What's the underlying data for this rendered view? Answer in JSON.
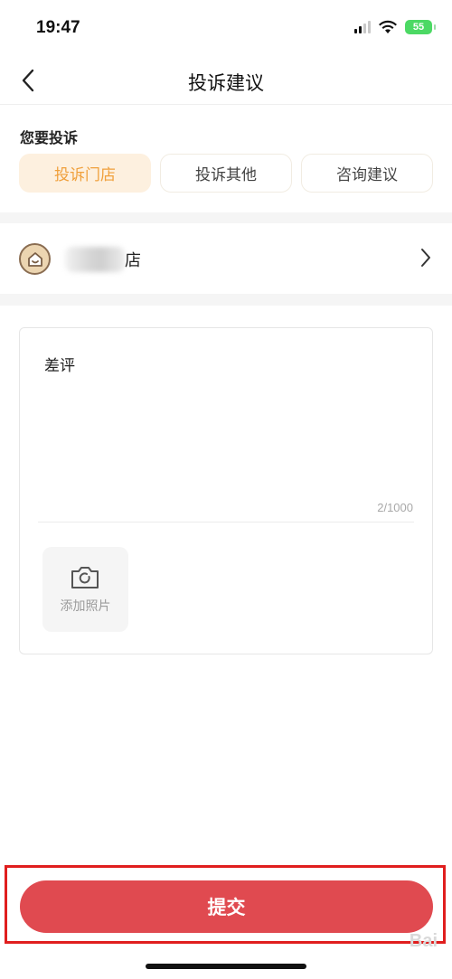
{
  "status_bar": {
    "time": "19:47",
    "battery": "55",
    "icons": [
      "signal-icon",
      "wifi-icon",
      "battery-icon"
    ]
  },
  "nav": {
    "title": "投诉建议",
    "back_icon": "chevron-left-icon"
  },
  "complaint_type": {
    "label": "您要投诉",
    "tabs": [
      {
        "label": "投诉门店",
        "active": true
      },
      {
        "label": "投诉其他",
        "active": false
      },
      {
        "label": "咨询建议",
        "active": false
      }
    ]
  },
  "store": {
    "name_visible": "店",
    "icon": "store-house-icon",
    "chevron": "chevron-right-icon"
  },
  "feedback": {
    "text": "差评",
    "char_count": "2/1000",
    "add_photo_label": "添加照片",
    "photo_icon": "camera-icon"
  },
  "submit": {
    "label": "提交"
  },
  "watermark": "Bai",
  "colors": {
    "accent_orange": "#f0a03c",
    "tab_active_bg": "#fdf0df",
    "submit_red": "#e04a50",
    "highlight_red": "#e01e1e"
  }
}
